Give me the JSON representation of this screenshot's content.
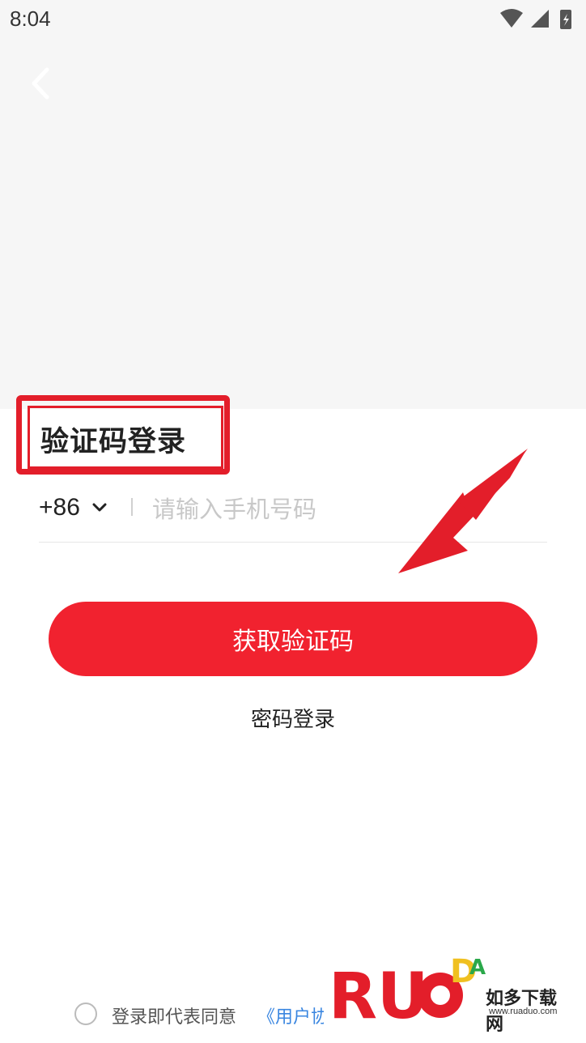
{
  "status_bar": {
    "time": "8:04"
  },
  "header": {
    "back_icon": "chevron-left-icon"
  },
  "login": {
    "title": "验证码登录",
    "country_code": "+86",
    "phone_placeholder": "请输入手机号码",
    "phone_value": "",
    "get_code_label": "获取验证码",
    "password_login_label": "密码登录"
  },
  "agreement": {
    "text": "登录即代表同意",
    "link": "《用户协议》"
  },
  "watermark": {
    "logo_text": "RUANDADUO",
    "cn": "如多下载网",
    "url": "www.ruaduo.com"
  },
  "colors": {
    "accent": "#f1222f",
    "link": "#3a86e0",
    "annotation": "#e31e2a"
  }
}
